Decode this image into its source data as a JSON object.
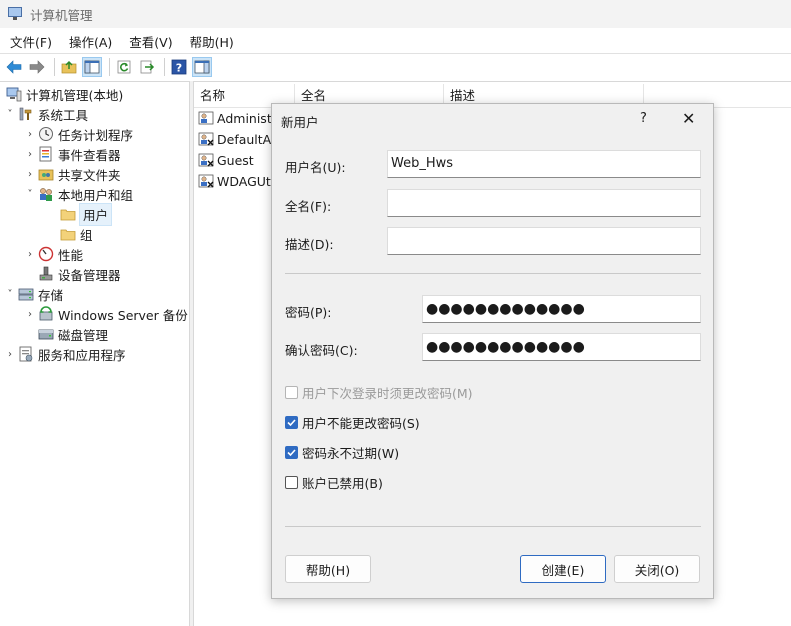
{
  "window": {
    "title": "计算机管理"
  },
  "menu": [
    "文件(F)",
    "操作(A)",
    "查看(V)",
    "帮助(H)"
  ],
  "toolbar": {
    "icons": [
      "back-arrow-icon",
      "forward-arrow-icon",
      "up-folder-icon",
      "show-tree-icon",
      "refresh-icon",
      "export-icon",
      "help-icon",
      "action-pane-icon"
    ]
  },
  "tree": {
    "items": [
      {
        "label": "计算机管理(本地)",
        "chevron": "",
        "icon": "computer-icon"
      },
      {
        "label": "系统工具",
        "chevron": "˅",
        "icon": "tools-icon"
      },
      {
        "label": "任务计划程序",
        "chevron": "›",
        "icon": "clock-icon"
      },
      {
        "label": "事件查看器",
        "chevron": "›",
        "icon": "event-viewer-icon"
      },
      {
        "label": "共享文件夹",
        "chevron": "›",
        "icon": "shared-folder-icon"
      },
      {
        "label": "本地用户和组",
        "chevron": "˅",
        "icon": "users-group-icon"
      },
      {
        "label": "用户",
        "chevron": "",
        "icon": "folder-icon"
      },
      {
        "label": "组",
        "chevron": "",
        "icon": "folder-icon"
      },
      {
        "label": "性能",
        "chevron": "›",
        "icon": "performance-icon"
      },
      {
        "label": "设备管理器",
        "chevron": "",
        "icon": "device-manager-icon"
      },
      {
        "label": "存储",
        "chevron": "˅",
        "icon": "storage-icon"
      },
      {
        "label": "Windows Server 备份",
        "chevron": "›",
        "icon": "backup-icon"
      },
      {
        "label": "磁盘管理",
        "chevron": "",
        "icon": "disk-icon"
      },
      {
        "label": "服务和应用程序",
        "chevron": "›",
        "icon": "services-icon"
      }
    ]
  },
  "list": {
    "columns": [
      "名称",
      "全名",
      "描述"
    ],
    "rows": [
      "Administr",
      "DefaultAc",
      "Guest",
      "WDAGUti"
    ]
  },
  "dialog": {
    "title": "新用户",
    "help": "?",
    "close": "✕",
    "username_label": "用户名(U):",
    "username_value": "Web_Hws",
    "fullname_label": "全名(F):",
    "fullname_value": "",
    "description_label": "描述(D):",
    "description_value": "",
    "password_label": "密码(P):",
    "password_value": "●●●●●●●●●●●●●",
    "confirm_label": "确认密码(C):",
    "confirm_value": "●●●●●●●●●●●●●",
    "checkboxes": [
      {
        "label": "用户下次登录时须更改密码(M)",
        "checked": false,
        "disabled": true
      },
      {
        "label": "用户不能更改密码(S)",
        "checked": true,
        "disabled": false
      },
      {
        "label": "密码永不过期(W)",
        "checked": true,
        "disabled": false
      },
      {
        "label": "账户已禁用(B)",
        "checked": false,
        "disabled": false
      }
    ],
    "help_button": "帮助(H)",
    "create_button": "创建(E)",
    "close_button": "关闭(O)"
  },
  "colors": {
    "accent": "#2f6bc2",
    "selection": "#e5f1fb",
    "dialog_bg": "#f0f0f0"
  }
}
